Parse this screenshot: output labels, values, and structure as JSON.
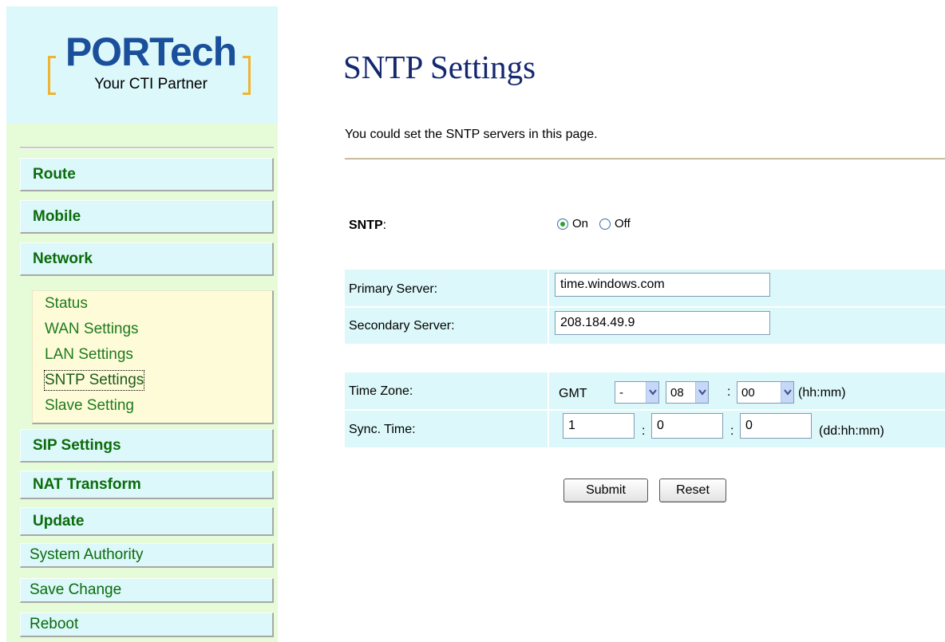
{
  "logo": {
    "brand": "PORTech",
    "tagline": "Your CTI Partner"
  },
  "sidebar": {
    "menu": [
      {
        "label": "Route"
      },
      {
        "label": "Mobile"
      },
      {
        "label": "Network"
      }
    ],
    "submenu": [
      {
        "label": "Status"
      },
      {
        "label": "WAN Settings"
      },
      {
        "label": "LAN Settings"
      },
      {
        "label": "SNTP Settings"
      },
      {
        "label": "Slave Setting"
      }
    ],
    "menu_bottom": [
      {
        "label": "SIP Settings"
      },
      {
        "label": "NAT Transform"
      },
      {
        "label": "Update"
      }
    ],
    "menu_plain": [
      {
        "label": "System Authority"
      },
      {
        "label": "Save Change"
      },
      {
        "label": "Reboot"
      }
    ]
  },
  "page": {
    "title": "SNTP Settings",
    "description": "You could set the SNTP servers in this page."
  },
  "form": {
    "sntp": {
      "label": "SNTP",
      "colon": ":",
      "on_label": "On",
      "off_label": "Off",
      "selected": "On"
    },
    "primary_server": {
      "label": "Primary Server:",
      "value": "time.windows.com"
    },
    "secondary_server": {
      "label": "Secondary Server:",
      "value": "208.184.49.9"
    },
    "time_zone": {
      "label": "Time Zone:",
      "prefix": "GMT",
      "sign": "-",
      "hours": "08",
      "minutes": "00",
      "separator": ":",
      "format": "(hh:mm)"
    },
    "sync_time": {
      "label": "Sync. Time:",
      "days": "1",
      "hours": "0",
      "minutes": "0",
      "separator": ":",
      "format": "(dd:hh:mm)"
    },
    "buttons": {
      "submit": "Submit",
      "reset": "Reset"
    }
  },
  "colors": {
    "sidebar_bg": "#e6fbd8",
    "menu_bg": "#dcf8fa",
    "submenu_bg": "#fefcd8",
    "menu_text": "#0b6b0b",
    "title": "#14286e",
    "logo_blue": "#1a4f9c",
    "logo_orange": "#f0b430"
  }
}
